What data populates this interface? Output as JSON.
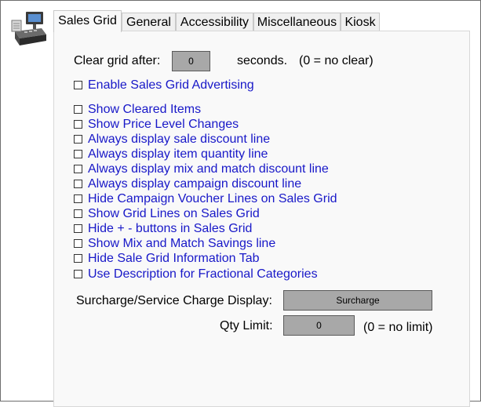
{
  "tabs": [
    {
      "label": "Sales Grid",
      "active": true
    },
    {
      "label": "General",
      "active": false
    },
    {
      "label": "Accessibility",
      "active": false
    },
    {
      "label": "Miscellaneous",
      "active": false
    },
    {
      "label": "Kiosk",
      "active": false
    }
  ],
  "clear_grid": {
    "label": "Clear grid after:",
    "value": "0",
    "unit": "seconds.",
    "hint": "(0 = no clear)"
  },
  "advertising": {
    "label": "Enable Sales Grid Advertising",
    "checked": false
  },
  "options": [
    {
      "label": "Show Cleared Items",
      "checked": false
    },
    {
      "label": "Show Price Level Changes",
      "checked": false
    },
    {
      "label": "Always display sale discount line",
      "checked": false
    },
    {
      "label": "Always display item quantity line",
      "checked": false
    },
    {
      "label": "Always display mix and match discount line",
      "checked": false
    },
    {
      "label": "Always display campaign discount line",
      "checked": false
    },
    {
      "label": "Hide Campaign Voucher Lines on Sales Grid",
      "checked": false
    },
    {
      "label": "Show Grid Lines on Sales Grid",
      "checked": false
    },
    {
      "label": "Hide + - buttons in Sales Grid",
      "checked": false
    },
    {
      "label": "Show Mix and Match Savings line",
      "checked": false
    },
    {
      "label": "Hide Sale Grid Information Tab",
      "checked": false
    },
    {
      "label": "Use Description for Fractional Categories",
      "checked": false
    }
  ],
  "surcharge": {
    "label": "Surcharge/Service Charge Display:",
    "value": "Surcharge"
  },
  "qty_limit": {
    "label": "Qty Limit:",
    "value": "0",
    "hint": "(0 = no limit)"
  },
  "colors": {
    "option_text": "#1818c8",
    "field_bg": "#a8a8a8"
  },
  "icons": {
    "app": "cash-register-icon"
  }
}
